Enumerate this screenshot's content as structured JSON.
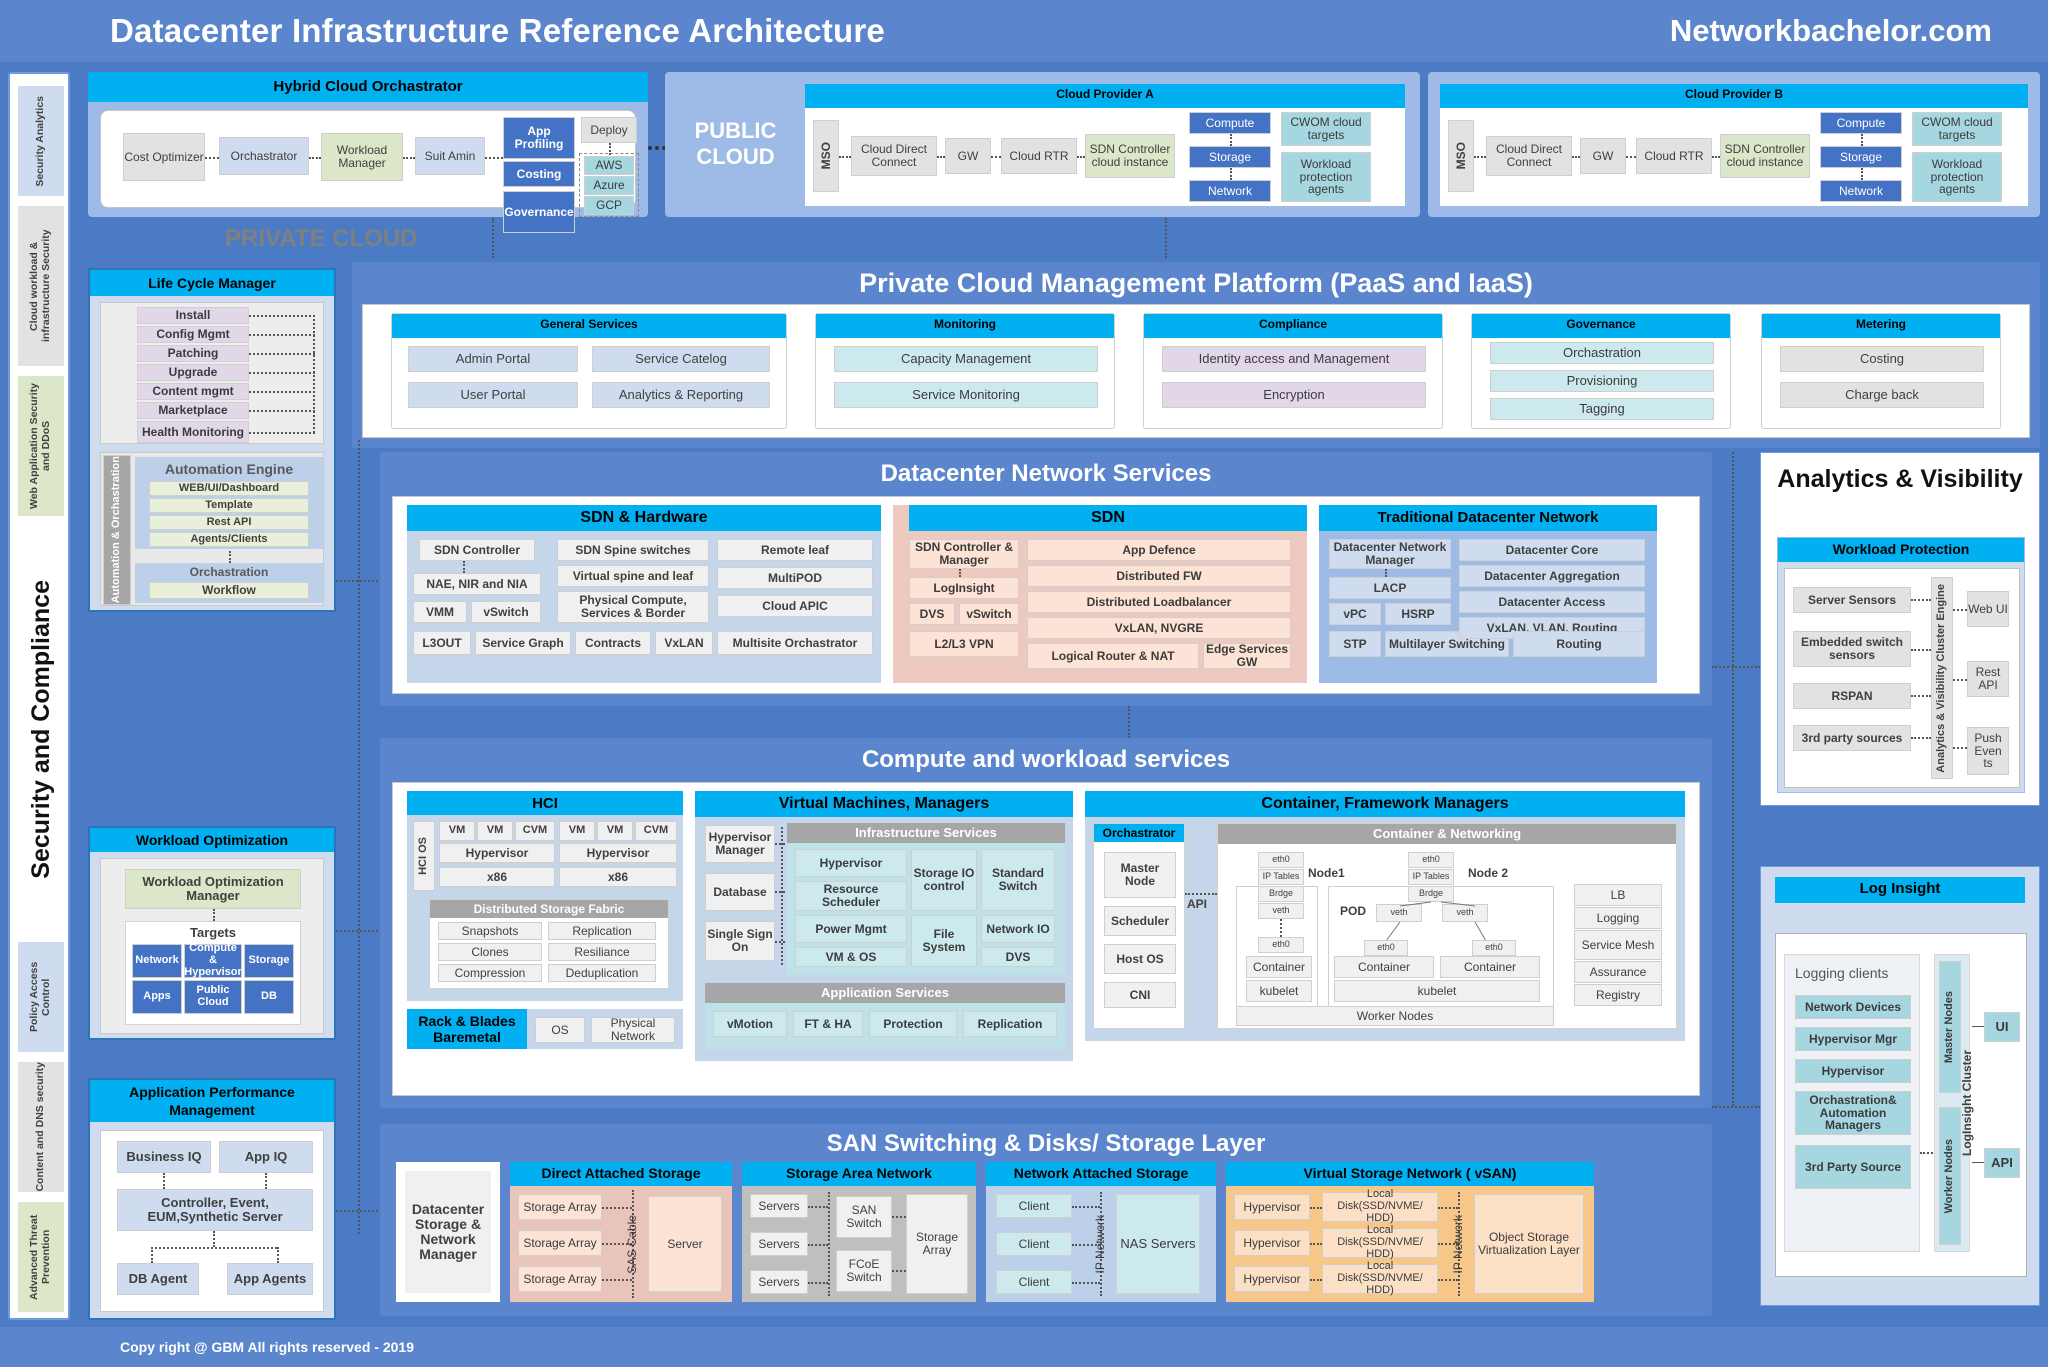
{
  "header": {
    "title": "Datacenter Infrastructure Reference Architecture",
    "brand": "Networkbachelor.com"
  },
  "footer": {
    "text": "Copy right @ GBM All rights reserved  - 2019"
  },
  "security_rail": {
    "title": "Security and Compliance",
    "top_chips": [
      "Security Analytics",
      "Cloud workload & infrastructure Security",
      "Web Application Security and DDoS"
    ],
    "bottom_chips": [
      "Policy Access Control",
      "Content and DNS security",
      "Advanced Threat Prevention"
    ]
  },
  "hybrid_cloud": {
    "caption": "Hybrid Cloud Orchastrator",
    "private_cloud_label": "PRIVATE CLOUD",
    "chain": [
      "Cost Optimizer",
      "Orchastrator",
      "Workload Manager",
      "Suit Amin"
    ],
    "right_blocks": [
      "App Profiling",
      "Costing",
      "Governance"
    ],
    "deploy": "Deploy",
    "clouds": [
      "AWS",
      "Azure",
      "GCP"
    ]
  },
  "public_cloud": {
    "label": "PUBLIC CLOUD",
    "providers": [
      {
        "name": "Cloud Provider A",
        "mso": "MSO",
        "chain": [
          "Cloud Direct Connect",
          "GW",
          "Cloud RTR"
        ],
        "sdn": "SDN Controller cloud instance",
        "stack": [
          "Compute",
          "Storage",
          "Network"
        ],
        "services": [
          "CWOM cloud targets",
          "Workload protection agents"
        ]
      },
      {
        "name": "Cloud Provider B",
        "mso": "MSO",
        "chain": [
          "Cloud Direct Connect",
          "GW",
          "Cloud RTR"
        ],
        "sdn": "SDN Controller cloud instance",
        "stack": [
          "Compute",
          "Storage",
          "Network"
        ],
        "services": [
          "CWOM cloud targets",
          "Workload protection agents"
        ]
      }
    ]
  },
  "pcmp": {
    "title": "Private Cloud Management Platform (PaaS and IaaS)",
    "groups": [
      {
        "caption": "General Services",
        "items": [
          "Admin Portal",
          "Service Catelog",
          "User Portal",
          "Analytics & Reporting"
        ],
        "style": "grid2"
      },
      {
        "caption": "Monitoring",
        "items": [
          "Capacity Management",
          "Service Monitoring"
        ],
        "style": "stack"
      },
      {
        "caption": "Compliance",
        "items": [
          "Identity access and Management",
          "Encryption"
        ],
        "style": "stack"
      },
      {
        "caption": "Governance",
        "items": [
          "Orchastration",
          "Provisioning",
          "Tagging"
        ],
        "style": "stack3"
      },
      {
        "caption": "Metering",
        "items": [
          "Costing",
          "Charge back"
        ],
        "style": "stack"
      }
    ]
  },
  "lifecycle": {
    "caption": "Life Cycle Manager",
    "items": [
      "Install",
      "Config Mgmt",
      "Patching",
      "Upgrade",
      "Content mgmt",
      "Marketplace",
      "Health Monitoring"
    ],
    "side_label": "Automation & Orchastration",
    "engine_title": "Automation Engine",
    "engine_items": [
      "WEB/UI/Dashboard",
      "Template",
      "Rest API",
      "Agents/Clients"
    ],
    "orch_title": "Orchastration",
    "orch_items": [
      "Workflow"
    ]
  },
  "workload_optimization": {
    "caption": "Workload Optimization",
    "manager": "Workload Optimization Manager",
    "targets_label": "Targets",
    "targets": [
      "Network",
      "Compute & Hypervisor",
      "Storage",
      "Apps",
      "Public Cloud",
      "DB"
    ]
  },
  "apm": {
    "caption": "Application Performance Management",
    "top": [
      "Business IQ",
      "App IQ"
    ],
    "middle": "Controller, Event, EUM,Synthetic Server",
    "bottom": [
      "DB Agent",
      "App Agents"
    ]
  },
  "network_services": {
    "title": "Datacenter Network Services",
    "sdn_hw": {
      "caption": "SDN  & Hardware",
      "col1": [
        "SDN Controller",
        "NAE, NIR and NIA",
        "VMM",
        "vSwitch"
      ],
      "col2": [
        "SDN Spine switches",
        "Virtual spine and leaf",
        "Physical Compute, Services & Border"
      ],
      "col3": [
        "Remote leaf",
        "MultiPOD",
        "Cloud APIC"
      ],
      "row_bottom": [
        "L3OUT",
        "Service Graph",
        "Contracts",
        "VxLAN",
        "Multisite Orchastrator"
      ]
    },
    "sdn": {
      "caption": "SDN",
      "col1": [
        "SDN Controller & Manager",
        "LogInsight",
        "DVS",
        "vSwitch",
        "L2/L3 VPN"
      ],
      "col2": [
        "App Defence",
        "Distributed FW",
        "Distributed Loadbalancer",
        "VxLAN, NVGRE",
        "Logical Router & NAT",
        "Edge Services GW"
      ]
    },
    "traditional": {
      "caption": "Traditional Datacenter Network",
      "col1": [
        "Datacenter Network Manager",
        "LACP",
        "vPC",
        "HSRP",
        "STP",
        "Multilayer Switching"
      ],
      "col2": [
        "Datacenter Core",
        "Datacenter Aggregation",
        "Datacenter Access",
        "VxLAN, VLAN, Routing",
        "Routing"
      ]
    }
  },
  "compute": {
    "title": "Compute and workload services",
    "hci": {
      "caption": "HCI",
      "os_label": "HCI OS",
      "node1": [
        "VM",
        "VM",
        "CVM"
      ],
      "node2": [
        "VM",
        "VM",
        "CVM"
      ],
      "hypervisor": "Hypervisor",
      "x86": "x86",
      "fabric_title": "Distributed Storage Fabric",
      "fabric_items": [
        "Snapshots",
        "Replication",
        "Clones",
        "Resiliance",
        "Compression",
        "Deduplication"
      ]
    },
    "baremetal": {
      "caption": "Rack & Blades Baremetal",
      "items": [
        "OS",
        "Physical Network"
      ]
    },
    "vm": {
      "caption": "Virtual Machines, Managers",
      "left": [
        "Hypervisor Manager",
        "Database",
        "Single Sign On"
      ],
      "infra_title": "Infrastructure Services",
      "infra": [
        "Hypervisor",
        "Storage IO control",
        "Standard Switch",
        "Resource Scheduler",
        "Power Mgmt",
        "File System",
        "Network IO",
        "VM & OS",
        "DVS"
      ],
      "app_title": "Application Services",
      "app": [
        "vMotion",
        "FT & HA",
        "Protection",
        "Replication"
      ]
    },
    "container": {
      "caption": "Container, Framework Managers",
      "orch_label": "Orchastrator",
      "orch_items": [
        "Master Node",
        "Scheduler",
        "Host OS",
        "CNI"
      ],
      "api": "API",
      "net_title": "Container & Networking",
      "node1_label": "Node1",
      "node2_label": "Node 2",
      "pod_label": "POD",
      "eth": "eth0",
      "iptables": "IP Tables",
      "bridge": "Brdge",
      "veth": "veth",
      "container": "Container",
      "kubelet": "kubelet",
      "worker_nodes": "Worker Nodes",
      "right_items": [
        "LB",
        "Logging",
        "Service Mesh",
        "Assurance",
        "Registry"
      ]
    }
  },
  "storage": {
    "title": "SAN Switching & Disks/ Storage Layer",
    "manager": "Datacenter Storage & Network Manager",
    "das": {
      "caption": "Direct Attached Storage",
      "arrays": [
        "Storage Array",
        "Storage Array",
        "Storage Array"
      ],
      "cable": "SAS Cable",
      "server": "Server"
    },
    "san": {
      "caption": "Storage Area Network",
      "servers": [
        "Servers",
        "Servers",
        "Servers"
      ],
      "switches": [
        "SAN Switch",
        "FCoE Switch"
      ],
      "array": "Storage Array"
    },
    "nas": {
      "caption": "Network Attached Storage",
      "clients": [
        "Client",
        "Client",
        "Client"
      ],
      "network": "IP Network",
      "servers": "NAS Servers"
    },
    "vsan": {
      "caption": "Virtual Storage Network ( vSAN)",
      "hypervisors": [
        "Hypervisor",
        "Hypervisor",
        "Hypervisor"
      ],
      "disks": [
        "Local Disk(SSD/NVME/ HDD)",
        "Local Disk(SSD/NVME/ HDD)",
        "Local Disk(SSD/NVME/ HDD)"
      ],
      "network": "IP Network",
      "object": "Object Storage Virtualization Layer"
    }
  },
  "analytics": {
    "title": "Analytics & Visibility",
    "workload_protection": {
      "caption": "Workload Protection",
      "sources": [
        "Server  Sensors",
        "Embedded switch sensors",
        "RSPAN",
        "3rd party sources"
      ],
      "engine": "Analytics & Visibility Cluster Engine",
      "outputs": [
        "Web UI",
        "Rest API",
        "Push Even ts"
      ]
    },
    "log_insight": {
      "caption": "Log Insight",
      "clients_label": "Logging clients",
      "clients": [
        "Network Devices",
        "Hypervisor Mgr",
        "Hypervisor",
        "Orchastration& Automation Managers",
        "3rd Party Source"
      ],
      "cluster_label": "LogInsight Cluster",
      "nodes": [
        "Master Nodes",
        "Worker Nodes"
      ],
      "outputs": [
        "UI",
        "API"
      ]
    }
  }
}
